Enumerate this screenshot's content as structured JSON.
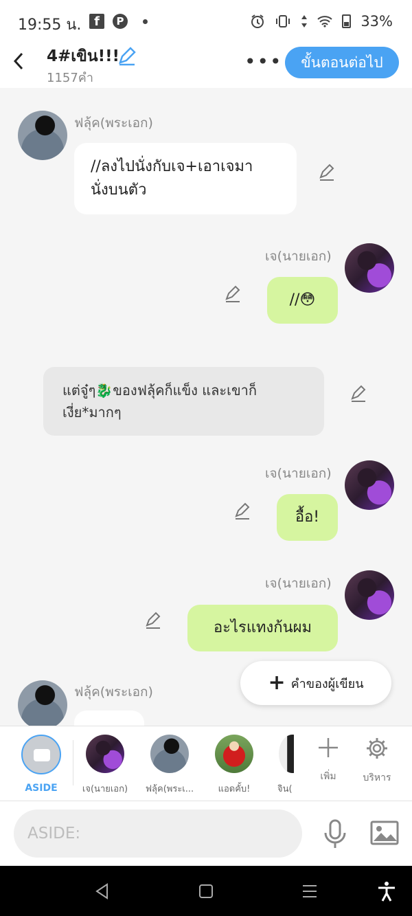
{
  "status_bar": {
    "time": "19:55 น.",
    "battery": "33%"
  },
  "header": {
    "title": "4#เขิน!!!",
    "subtitle": "1157คำ",
    "next_label": "ขั้นตอนต่อไป"
  },
  "messages": [
    {
      "speaker": "ฟลุ้ค(พระเอก)",
      "text_line1": "//ลงไปนั่งกับเจ+เอาเจมา",
      "text_line2": "นั่งบนตัว"
    },
    {
      "speaker": "เจ(นายเอก)",
      "text": "//😳"
    },
    {
      "narration_line1": "แต่จู๋ๆ🐉ของฟลุ้คก็แข็ง และเขาก็",
      "narration_line2": "เงี่ย*มากๆ"
    },
    {
      "speaker": "เจ(นายเอก)",
      "text": "อื้อ!"
    },
    {
      "speaker": "เจ(นายเอก)",
      "text": "อะไรแทงก้นผม"
    },
    {
      "speaker": "ฟลุ้ค(พระเอก)"
    }
  ],
  "writer_button": {
    "label": "คำของผู้เขียน"
  },
  "characters": [
    {
      "label": "ASIDE"
    },
    {
      "label": "เจ(นายเอก)"
    },
    {
      "label": "ฟลุ้ค(พระเ..."
    },
    {
      "label": "แอดคั้บ!"
    },
    {
      "label": "จิน("
    }
  ],
  "tools": {
    "add_label": "เพิ่ม",
    "manage_label": "บริหาร"
  },
  "input": {
    "placeholder": "ASIDE:"
  },
  "colors": {
    "accent": "#4aa3f3",
    "bubble_green": "#d6f5a0",
    "narration": "#e8e8e8"
  }
}
